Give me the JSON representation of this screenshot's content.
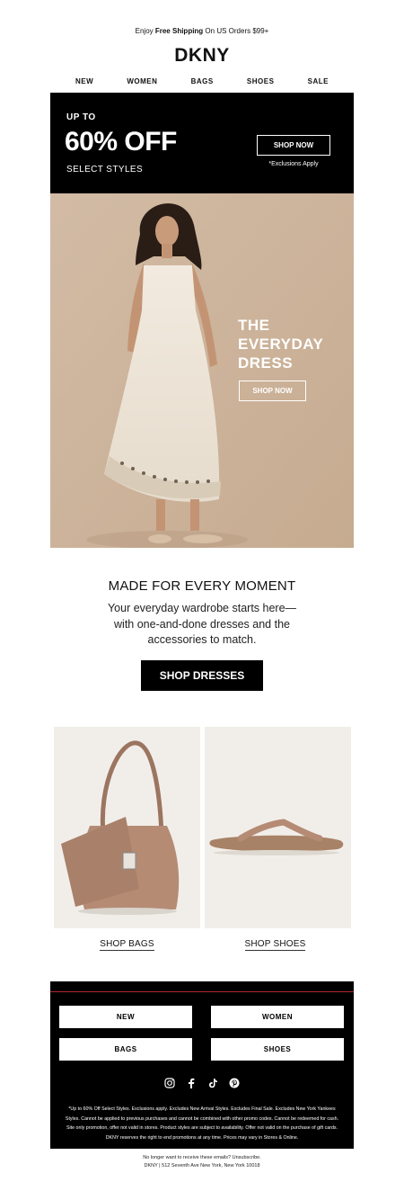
{
  "topbar": {
    "prefix": "Enjoy ",
    "bold": "Free Shipping",
    "suffix": " On US Orders $99+"
  },
  "brand": {
    "logo": "DKNY"
  },
  "nav": {
    "items": [
      "NEW",
      "WOMEN",
      "BAGS",
      "SHOES",
      "SALE"
    ]
  },
  "promo": {
    "up_to": "UP TO",
    "headline": "60% OFF",
    "subline": "SELECT STYLES",
    "button": "SHOP NOW",
    "note": "*Exclusions Apply"
  },
  "hero": {
    "headline_lines": [
      "THE",
      "EVERYDAY",
      "DRESS"
    ],
    "button": "SHOP NOW"
  },
  "section": {
    "title": "MADE FOR EVERY MOMENT",
    "body": "Your everyday wardrobe starts here—with one-and-done dresses and the accessories to match.",
    "button": "SHOP DRESSES"
  },
  "products": [
    {
      "link": "SHOP BAGS",
      "icon": "bag-image"
    },
    {
      "link": "SHOP SHOES",
      "icon": "sandal-image"
    }
  ],
  "footer": {
    "buttons": [
      "NEW",
      "WOMEN",
      "BAGS",
      "SHOES"
    ],
    "social": [
      "instagram-icon",
      "facebook-icon",
      "tiktok-icon",
      "pinterest-icon"
    ],
    "disclaimer": "*Up to 60% Off Select Styles. Exclusions apply. Excludes New Arrival Styles. Excludes Final Sale. Excludes New York Yankees Styles. Cannot be applied to previous purchases and cannot be combined with other promo codes. Cannot be redeemed for cash. Site only promotion, offer not valid in stores. Product styles are subject to availability. Offer not valid on the purchase of gift cards. DKNY reserves the right to end promotions at any time. Prices may vary in Stores & Online."
  },
  "bottom": {
    "unsubscribe": "No longer want to receive these emails? Unsubscribe.",
    "address": "DKNY | 512 Seventh Ave New York, New York 10018"
  },
  "colors": {
    "black": "#000000",
    "hero_bg": "#cdb49c",
    "product_bg": "#f1eeea",
    "accent_line": "#b3262b",
    "leather": "#b58b74"
  }
}
